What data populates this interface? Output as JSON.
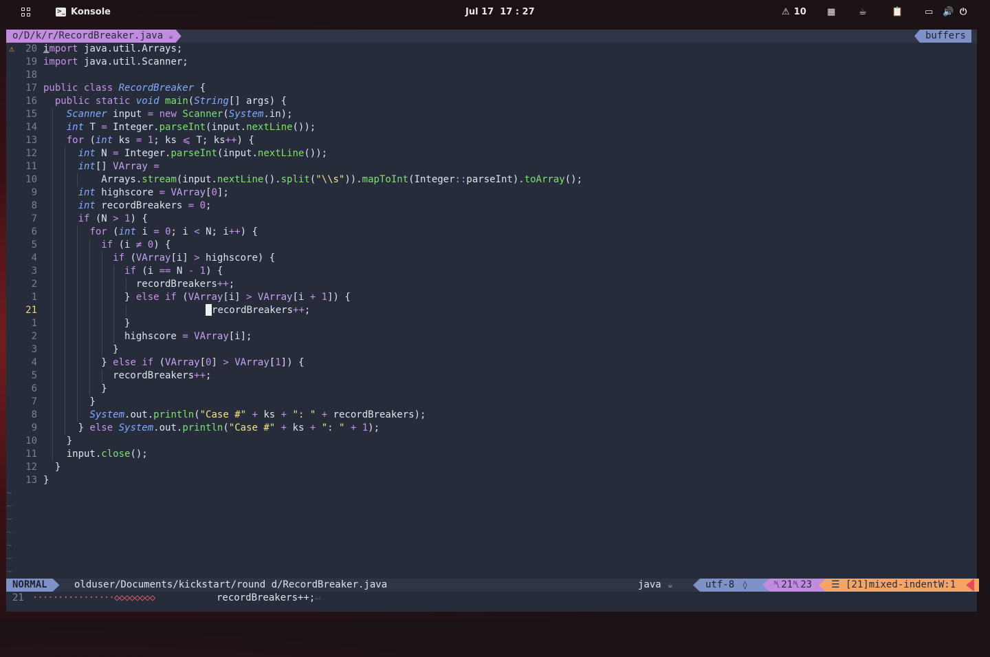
{
  "topbar": {
    "app_name": "Konsole",
    "datetime": "Jul 17  17 : 27",
    "notification_count": "10",
    "icons": [
      "grid-icon",
      "konsole-icon",
      "bell-icon",
      "windows-icon",
      "cup-icon",
      "clipboard-icon",
      "monitor-icon",
      "volume-icon",
      "power-icon"
    ]
  },
  "editor": {
    "buffer_name": "o/D/k/r/RecordBreaker.java",
    "buffer_icon": "☕",
    "buffers_label": "buffers",
    "sign_warning": "⚠",
    "lines": [
      {
        "num": "20",
        "sign": "⚠",
        "indent": 0,
        "html": "<span style='text-decoration:underline'>i</span><span class='kw'>mport</span> java.util.Arrays;"
      },
      {
        "num": "19",
        "indent": 0,
        "html": "<span class='kw'>import</span> java.util.Scanner;"
      },
      {
        "num": "18",
        "indent": 0,
        "html": ""
      },
      {
        "num": "17",
        "indent": 0,
        "html": "<span class='kw'>public class</span> <span class='cl'>RecordBreaker</span> {"
      },
      {
        "num": "16",
        "indent": 1,
        "html": "  <span class='kw'>public static</span> <span class='ty'>void</span> <span class='fn'>main</span>(<span class='ty'>String</span>[] args) {"
      },
      {
        "num": "15",
        "indent": 2,
        "html": "    <span class='ty'>Scanner</span> input <span class='op'>=</span> <span class='kw'>new</span> <span class='fn'>Scanner</span>(<span class='ty'>System</span>.in);"
      },
      {
        "num": "14",
        "indent": 2,
        "html": "    <span class='ty'>int</span> T <span class='op'>=</span> Integer.<span class='fn'>parseInt</span>(input.<span class='fn'>nextLine</span>());"
      },
      {
        "num": "13",
        "indent": 2,
        "html": "    <span class='kw'>for</span> (<span class='ty'>int</span> ks <span class='op'>=</span> <span class='nm'>1</span>; ks <span class='op'>⩽</span> T; ks<span class='op'>++</span>) {"
      },
      {
        "num": "12",
        "indent": 3,
        "html": "      <span class='ty'>int</span> N <span class='op'>=</span> Integer.<span class='fn'>parseInt</span>(input.<span class='fn'>nextLine</span>());"
      },
      {
        "num": "11",
        "indent": 3,
        "html": "      <span class='ty'>int</span>[] <span class='vr'>VArray</span> <span class='op'>=</span>"
      },
      {
        "num": "10",
        "indent": 4,
        "html": "          Arrays.<span class='fn'>stream</span>(input.<span class='fn'>nextLine</span>().<span class='fn'>split</span>(<span class='st'>\"\\\\s\"</span>)).<span class='fn'>mapToInt</span>(Integer<span class='op'>::</span>parseInt).<span class='fn'>toArray</span>();"
      },
      {
        "num": "9",
        "indent": 3,
        "html": "      <span class='ty'>int</span> highscore <span class='op'>=</span> <span class='vr'>VArray</span>[<span class='nm'>0</span>];"
      },
      {
        "num": "8",
        "indent": 3,
        "html": "      <span class='ty'>int</span> recordBreakers <span class='op'>=</span> <span class='nm'>0</span>;"
      },
      {
        "num": "7",
        "indent": 3,
        "html": "      <span class='kw'>if</span> (N <span class='op'>&gt;</span> <span class='nm'>1</span>) {"
      },
      {
        "num": "6",
        "indent": 4,
        "html": "        <span class='kw'>for</span> (<span class='ty'>int</span> i <span class='op'>=</span> <span class='nm'>0</span>; i <span class='op'>&lt;</span> N; i<span class='op'>++</span>) {"
      },
      {
        "num": "5",
        "indent": 5,
        "html": "          <span class='kw'>if</span> (i <span class='op'>≠</span> <span class='nm'>0</span>) {"
      },
      {
        "num": "4",
        "indent": 6,
        "html": "            <span class='kw'>if</span> (<span class='vr'>VArray</span>[i] <span class='op'>&gt;</span> highscore) {"
      },
      {
        "num": "3",
        "indent": 7,
        "html": "              <span class='kw'>if</span> (i <span class='op'>==</span> N <span class='op'>-</span> <span class='nm'>1</span>) {"
      },
      {
        "num": "2",
        "indent": 8,
        "html": "                recordBreakers<span class='op'>++</span>;"
      },
      {
        "num": "1",
        "indent": 7,
        "html": "              } <span class='kw'>else if</span> (<span class='vr'>VArray</span>[i] <span class='op'>&gt;</span> <span class='vr'>VArray</span>[i <span class='op'>+</span> <span class='nm'>1</span>]) {"
      },
      {
        "num": "21",
        "current": true,
        "indent": 8,
        "html": "                            <span class='cursor'></span>recordBreakers<span class='op'>++</span>;"
      },
      {
        "num": "1",
        "indent": 7,
        "html": "              }"
      },
      {
        "num": "2",
        "indent": 7,
        "html": "              highscore <span class='op'>=</span> <span class='vr'>VArray</span>[i];"
      },
      {
        "num": "3",
        "indent": 6,
        "html": "            }"
      },
      {
        "num": "4",
        "indent": 5,
        "html": "          } <span class='kw'>else if</span> (<span class='vr'>VArray</span>[<span class='nm'>0</span>] <span class='op'>&gt;</span> <span class='vr'>VArray</span>[<span class='nm'>1</span>]) {"
      },
      {
        "num": "5",
        "indent": 6,
        "html": "            recordBreakers<span class='op'>++</span>;"
      },
      {
        "num": "6",
        "indent": 5,
        "html": "          }"
      },
      {
        "num": "7",
        "indent": 4,
        "html": "        }"
      },
      {
        "num": "8",
        "indent": 4,
        "html": "        <span class='ty'>System</span>.out.<span class='fn'>println</span>(<span class='st'>\"Case #\"</span> <span class='op'>+</span> ks <span class='op'>+</span> <span class='st'>\": \"</span> <span class='op'>+</span> recordBreakers);"
      },
      {
        "num": "9",
        "indent": 3,
        "html": "      } <span class='kw'>else</span> <span class='ty'>System</span>.out.<span class='fn'>println</span>(<span class='st'>\"Case #\"</span> <span class='op'>+</span> ks <span class='op'>+</span> <span class='st'>\": \"</span> <span class='op'>+</span> <span class='nm'>1</span>);"
      },
      {
        "num": "10",
        "indent": 2,
        "html": "    }"
      },
      {
        "num": "11",
        "indent": 2,
        "html": "    input.<span class='fn'>close</span>();"
      },
      {
        "num": "12",
        "indent": 1,
        "html": "  }"
      },
      {
        "num": "13",
        "indent": 0,
        "html": "}"
      }
    ],
    "tilde_lines": [
      "~",
      "~",
      "~",
      "~",
      "~",
      "~",
      "~"
    ]
  },
  "statusline": {
    "mode": "NORMAL",
    "file_path": "olduser/Documents/kickstart/round d/RecordBreaker.java",
    "filetype": "java",
    "filetype_icon": "☕",
    "encoding": "utf-8",
    "encoding_icon": "🐧",
    "position": "␤21␤23",
    "warning": "☰ [21]mixed-indentW:1"
  },
  "cmdline": {
    "line_number": "21",
    "dots": "················◇◇◇◇◇◇◇◇",
    "text": "recordBreakers++;",
    "trail": "↵"
  },
  "colors": {
    "background": "#272c3b",
    "accent_blue": "#7f92c8",
    "accent_purple": "#c18be0",
    "accent_orange": "#f4a566",
    "error_red": "#e94a5a"
  }
}
